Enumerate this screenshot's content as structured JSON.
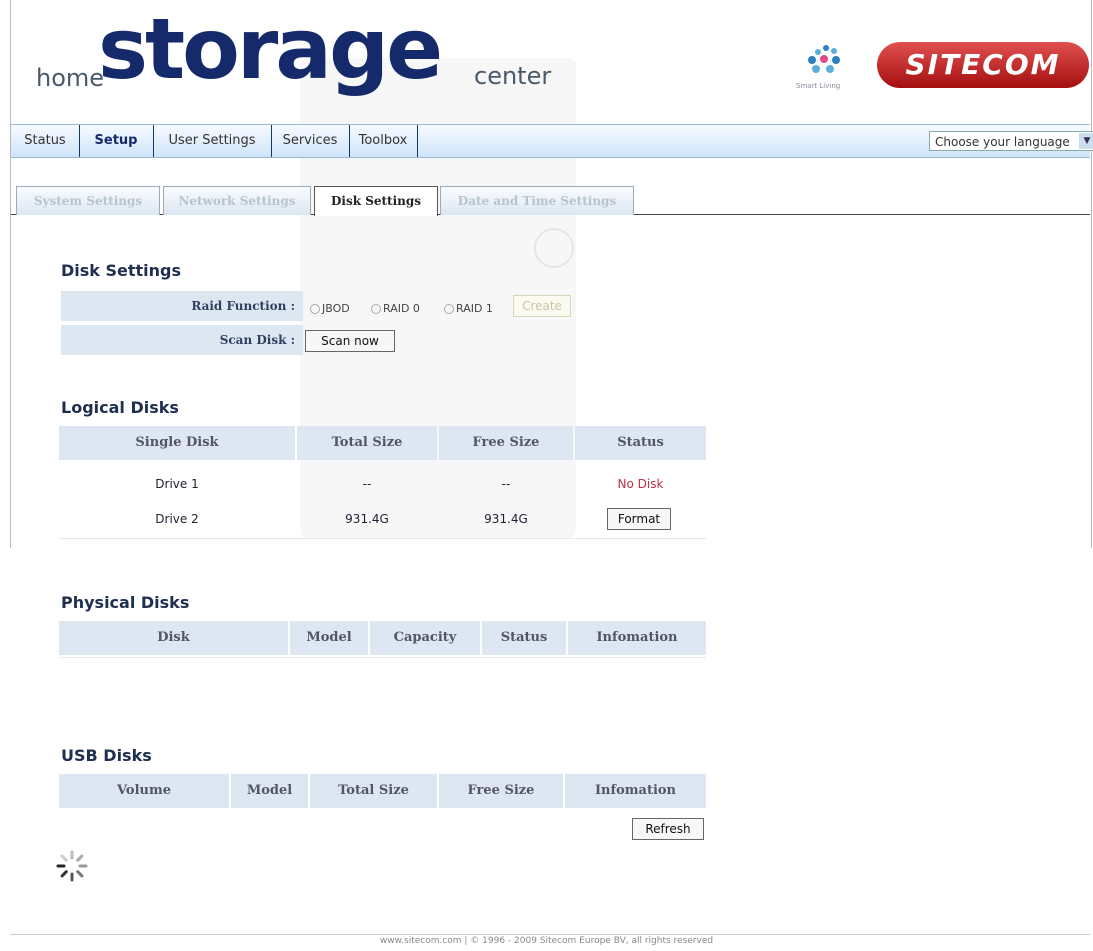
{
  "header": {
    "logo_home": "home",
    "logo_storage": "storage",
    "logo_center": "center",
    "smart_living": "Smart Living",
    "brand": "SITECOM"
  },
  "nav": {
    "items": [
      {
        "label": "Status"
      },
      {
        "label": "Setup",
        "active": true
      },
      {
        "label": "User Settings"
      },
      {
        "label": "Services"
      },
      {
        "label": "Toolbox"
      }
    ],
    "language": "Choose your language"
  },
  "subtabs": [
    {
      "label": "System Settings"
    },
    {
      "label": "Network Settings"
    },
    {
      "label": "Disk Settings",
      "active": true
    },
    {
      "label": "Date and Time Settings"
    }
  ],
  "disk_settings": {
    "title": "Disk Settings",
    "raid_label": "Raid Function :",
    "raid_options": [
      "JBOD",
      "RAID 0",
      "RAID 1"
    ],
    "create_label": "Create",
    "scan_label": "Scan Disk :",
    "scan_button": "Scan now"
  },
  "logical": {
    "title": "Logical Disks",
    "headers": [
      "Single Disk",
      "Total Size",
      "Free Size",
      "Status"
    ],
    "rows": [
      {
        "disk": "Drive 1",
        "total": "--",
        "free": "--",
        "status": "No Disk"
      },
      {
        "disk": "Drive 2",
        "total": "931.4G",
        "free": "931.4G",
        "status": "Format"
      }
    ]
  },
  "physical": {
    "title": "Physical Disks",
    "headers": [
      "Disk",
      "Model",
      "Capacity",
      "Status",
      "Infomation"
    ]
  },
  "usb": {
    "title": "USB Disks",
    "headers": [
      "Volume",
      "Model",
      "Total Size",
      "Free Size",
      "Infomation"
    ],
    "refresh_button": "Refresh"
  },
  "footer": "www.sitecom.com | © 1996 - 2009 Sitecom Europe BV, all rights reserved",
  "colors": {
    "navy": "#152a6a",
    "brand_red": "#c21a1a",
    "no_disk": "#c0304a",
    "header_cell": "#dce7f1"
  }
}
